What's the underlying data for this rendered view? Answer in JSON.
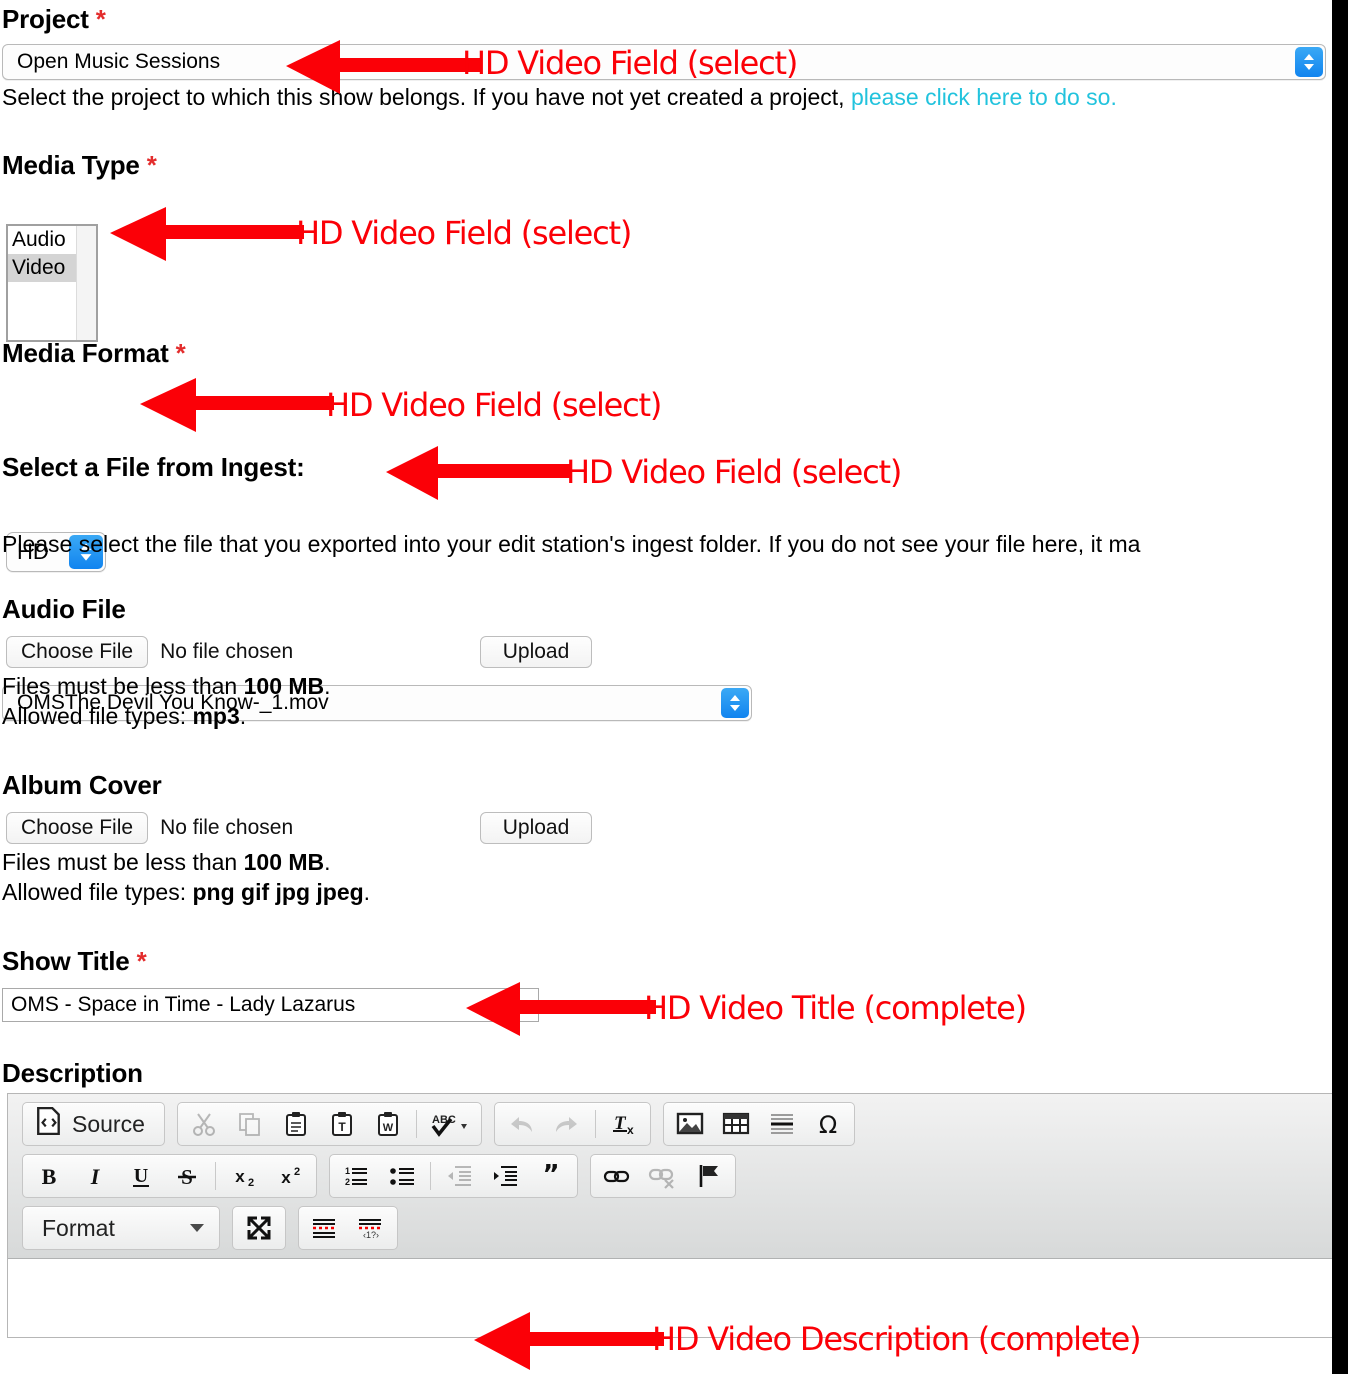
{
  "form": {
    "project": {
      "label": "Project",
      "required_mark": "*",
      "selected": "Open Music Sessions",
      "help_before": "Select the project to which this show belongs. If you have not yet created a project, ",
      "help_link": "please click here to do so."
    },
    "media_type": {
      "label": "Media Type",
      "required_mark": "*",
      "options": [
        "Audio",
        "Video"
      ],
      "selected": "Video"
    },
    "media_format": {
      "label": "Media Format",
      "required_mark": "*",
      "selected": "HD"
    },
    "ingest": {
      "label": "Select a File from Ingest:",
      "selected": "OMSThe Devil You Know-_1.mov",
      "help": "Please select the file that you exported into your edit station's ingest folder. If you do not see your file here, it ma"
    },
    "audio_file": {
      "label": "Audio File",
      "choose_label": "Choose File",
      "file_status": "No file chosen",
      "upload_label": "Upload",
      "size_prefix": "Files must be less than ",
      "size_value": "100 MB",
      "size_suffix": ".",
      "types_prefix": "Allowed file types: ",
      "types_value": "mp3",
      "types_suffix": "."
    },
    "album_cover": {
      "label": "Album Cover",
      "choose_label": "Choose File",
      "file_status": "No file chosen",
      "upload_label": "Upload",
      "size_prefix": "Files must be less than ",
      "size_value": "100 MB",
      "size_suffix": ".",
      "types_prefix": "Allowed file types: ",
      "types_value": "png gif jpg jpeg",
      "types_suffix": "."
    },
    "show_title": {
      "label": "Show Title",
      "required_mark": "*",
      "value": "OMS - Space in Time - Lady Lazarus"
    },
    "description": {
      "label": "Description",
      "body_text": ""
    }
  },
  "editor": {
    "source_label": "Source",
    "format_label": "Format",
    "row1_icons": [
      "cut-icon",
      "copy-icon",
      "paste-icon",
      "paste-text-icon",
      "paste-word-icon",
      "spellcheck-icon",
      "undo-icon",
      "redo-icon",
      "remove-format-icon",
      "image-icon",
      "table-icon",
      "horizontal-rule-icon",
      "special-char-icon"
    ],
    "row2_icons": [
      "bold-icon",
      "italic-icon",
      "underline-icon",
      "strikethrough-icon",
      "subscript-icon",
      "superscript-icon",
      "numbered-list-icon",
      "bulleted-list-icon",
      "outdent-icon",
      "indent-icon",
      "blockquote-icon",
      "link-icon",
      "unlink-icon",
      "anchor-icon"
    ],
    "row3_icons": [
      "maximize-icon",
      "show-blocks-icon",
      "templates-icon"
    ]
  },
  "annotations": [
    {
      "text": "HD Video Field (select)",
      "target": "project-select"
    },
    {
      "text": "HD Video Field (select)",
      "target": "media-type-listbox"
    },
    {
      "text": "HD Video Field (select)",
      "target": "media-format-select"
    },
    {
      "text": "HD Video Field (select)",
      "target": "ingest-label"
    },
    {
      "text": "HD Video Title (complete)",
      "target": "show-title-input"
    },
    {
      "text": "HD Video Description (complete)",
      "target": "description-editor-body"
    }
  ],
  "colors": {
    "annotation_red": "#fb0007",
    "link_cyan": "#22c3dd",
    "required_red": "#e32c2c",
    "select_blue": "#1184ef"
  }
}
